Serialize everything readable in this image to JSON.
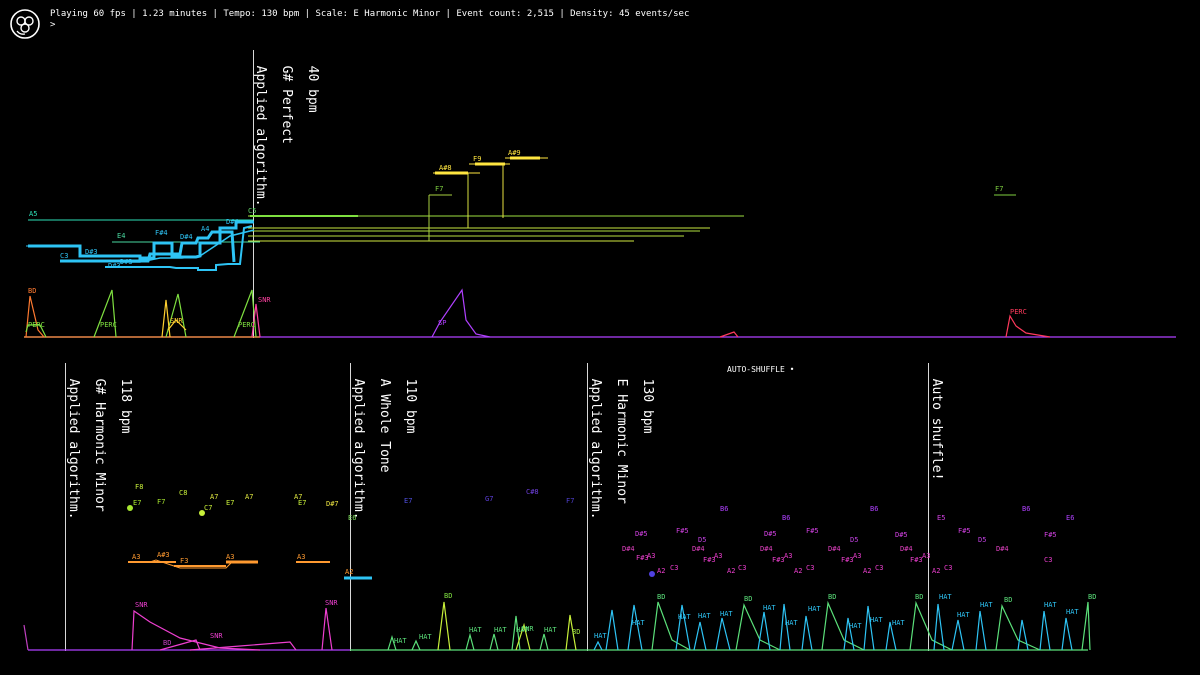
{
  "status": {
    "text": "Playing 60 fps | 1.23 minutes | Tempo: 130 bpm | Scale: E Harmonic Minor | Event count: 2,515 | Density: 45 events/sec",
    "prompt": ">"
  },
  "logo": {
    "icon": "swirl-logo-icon"
  },
  "colors": {
    "background": "#000000",
    "blue": "#2ec4f5",
    "green": "#5be07a",
    "yellow_green": "#c8f03a",
    "yellow": "#ffe640",
    "orange": "#ff9a30",
    "magenta": "#ee3fd0",
    "purple": "#b040ff",
    "red": "#ff3a5c"
  },
  "top_panel": {
    "marker": {
      "tempo": "40 bpm",
      "scale": "G# Perfect",
      "note": "Applied algorithm."
    },
    "labels": [
      {
        "text": "A5",
        "color": "#2ee0b8"
      },
      {
        "text": "E4",
        "color": "#48d9a0"
      },
      {
        "text": "F#4",
        "color": "#2ec4f5"
      },
      {
        "text": "D#4",
        "color": "#2ec4f5"
      },
      {
        "text": "A4",
        "color": "#2ec4f5"
      },
      {
        "text": "D#3",
        "color": "#2ec4f5"
      },
      {
        "text": "C3",
        "color": "#2ec4f5"
      },
      {
        "text": "D#3",
        "color": "#2ec4f5"
      },
      {
        "text": "D#3",
        "color": "#2ec4f5"
      },
      {
        "text": "D#4",
        "color": "#2ec4f5"
      },
      {
        "text": "C5",
        "color": "#64d86a"
      },
      {
        "text": "A#8",
        "color": "#ffe640"
      },
      {
        "text": "F9",
        "color": "#ffe640"
      },
      {
        "text": "A#9",
        "color": "#ffe640"
      },
      {
        "text": "F7",
        "color": "#7fd040"
      },
      {
        "text": "F7",
        "color": "#7fd040"
      },
      {
        "text": "BD",
        "color": "#ff7a30"
      },
      {
        "text": "PERC",
        "color": "#7fe040"
      },
      {
        "text": "PERC",
        "color": "#7fe040"
      },
      {
        "text": "SNR",
        "color": "#ffd030"
      },
      {
        "text": "PERC",
        "color": "#7fe040"
      },
      {
        "text": "SNR",
        "color": "#ff40a0"
      },
      {
        "text": "SP",
        "color": "#b040ff"
      },
      {
        "text": "PERC",
        "color": "#ff3a5c"
      }
    ]
  },
  "bottom_panel": {
    "badge": "AUTO-SHUFFLE •",
    "markers": [
      {
        "tempo": "118 bpm",
        "scale": "G# Harmonic Minor",
        "note": "Applied algorithm."
      },
      {
        "tempo": "110 bpm",
        "scale": "A Whole Tone",
        "note": "Applied algorithm."
      },
      {
        "tempo": "130 bpm",
        "scale": "E Harmonic Minor",
        "note": "Applied algorithm."
      },
      {
        "tempo": "",
        "scale": "",
        "note": "Auto shuffle!"
      }
    ],
    "labels": [
      {
        "text": "F8",
        "color": "#c8f03a"
      },
      {
        "text": "E7",
        "color": "#a8e830"
      },
      {
        "text": "F7",
        "color": "#a8e830"
      },
      {
        "text": "C8",
        "color": "#c8f03a"
      },
      {
        "text": "C7",
        "color": "#c8f03a"
      },
      {
        "text": "A7",
        "color": "#e0e840"
      },
      {
        "text": "E7",
        "color": "#c8f03a"
      },
      {
        "text": "A7",
        "color": "#e0e840"
      },
      {
        "text": "A7",
        "color": "#e0e840"
      },
      {
        "text": "E7",
        "color": "#c8f03a"
      },
      {
        "text": "D#7",
        "color": "#e8e040"
      },
      {
        "text": "E6",
        "color": "#80e060"
      },
      {
        "text": "A3",
        "color": "#ff9a30"
      },
      {
        "text": "A#3",
        "color": "#ff9a30"
      },
      {
        "text": "F3",
        "color": "#ff9a30"
      },
      {
        "text": "A3",
        "color": "#ff9a30"
      },
      {
        "text": "A3",
        "color": "#ff9a30"
      },
      {
        "text": "A2",
        "color": "#ff9a30"
      },
      {
        "text": "E7",
        "color": "#5050e0"
      },
      {
        "text": "G7",
        "color": "#6040e0"
      },
      {
        "text": "C#8",
        "color": "#7040e0"
      },
      {
        "text": "F7",
        "color": "#5040d0"
      },
      {
        "text": "B6",
        "color": "#b040ff"
      },
      {
        "text": "B6",
        "color": "#b040ff"
      },
      {
        "text": "B6",
        "color": "#b040ff"
      },
      {
        "text": "B6",
        "color": "#b040ff"
      },
      {
        "text": "D#5",
        "color": "#d040e0"
      },
      {
        "text": "F#5",
        "color": "#d040e0"
      },
      {
        "text": "D5",
        "color": "#c040e0"
      },
      {
        "text": "D#5",
        "color": "#d040e0"
      },
      {
        "text": "F#5",
        "color": "#d040e0"
      },
      {
        "text": "D5",
        "color": "#c040e0"
      },
      {
        "text": "D#5",
        "color": "#d040e0"
      },
      {
        "text": "E5",
        "color": "#d040e0"
      },
      {
        "text": "F#5",
        "color": "#d040e0"
      },
      {
        "text": "D5",
        "color": "#c040e0"
      },
      {
        "text": "F#5",
        "color": "#d040e0"
      },
      {
        "text": "E6",
        "color": "#b040ff"
      },
      {
        "text": "D#4",
        "color": "#e040c0"
      },
      {
        "text": "D#4",
        "color": "#e040c0"
      },
      {
        "text": "D#4",
        "color": "#e040c0"
      },
      {
        "text": "D#4",
        "color": "#e040c0"
      },
      {
        "text": "D#4",
        "color": "#e040c0"
      },
      {
        "text": "D#4",
        "color": "#e040c0"
      },
      {
        "text": "F#3",
        "color": "#ee3fd0"
      },
      {
        "text": "A3",
        "color": "#ee3fd0"
      },
      {
        "text": "F#3",
        "color": "#ee3fd0"
      },
      {
        "text": "A3",
        "color": "#ee3fd0"
      },
      {
        "text": "F#3",
        "color": "#ee3fd0"
      },
      {
        "text": "A3",
        "color": "#ee3fd0"
      },
      {
        "text": "F#3",
        "color": "#ee3fd0"
      },
      {
        "text": "A3",
        "color": "#ee3fd0"
      },
      {
        "text": "F#3",
        "color": "#ee3fd0"
      },
      {
        "text": "A3",
        "color": "#ee3fd0"
      },
      {
        "text": "C3",
        "color": "#ee3fd0"
      },
      {
        "text": "A2",
        "color": "#ee3fd0"
      },
      {
        "text": "C3",
        "color": "#ee3fd0"
      },
      {
        "text": "A2",
        "color": "#ee3fd0"
      },
      {
        "text": "C3",
        "color": "#ee3fd0"
      },
      {
        "text": "A2",
        "color": "#ee3fd0"
      },
      {
        "text": "C3",
        "color": "#ee3fd0"
      },
      {
        "text": "A2",
        "color": "#ee3fd0"
      },
      {
        "text": "C3",
        "color": "#ee3fd0"
      },
      {
        "text": "A2",
        "color": "#ee3fd0"
      },
      {
        "text": "C3",
        "color": "#ee3fd0"
      },
      {
        "text": "SNR",
        "color": "#ee3fd0"
      },
      {
        "text": "SNR",
        "color": "#ee3fd0"
      },
      {
        "text": "SNR",
        "color": "#ee3fd0"
      },
      {
        "text": "BD",
        "color": "#c040c0"
      },
      {
        "text": "BD",
        "color": "#7fe040"
      },
      {
        "text": "HAT",
        "color": "#5be07a"
      },
      {
        "text": "HAT",
        "color": "#5be07a"
      },
      {
        "text": "HAT",
        "color": "#5be07a"
      },
      {
        "text": "HAT",
        "color": "#5be07a"
      },
      {
        "text": "SNR",
        "color": "#5be07a"
      },
      {
        "text": "HAT",
        "color": "#5be07a"
      },
      {
        "text": "HAT",
        "color": "#5be07a"
      },
      {
        "text": "BD",
        "color": "#a0e040"
      },
      {
        "text": "HAT",
        "color": "#2ec4f5"
      },
      {
        "text": "HAT",
        "color": "#2ec4f5"
      },
      {
        "text": "BD",
        "color": "#5be07a"
      },
      {
        "text": "HAT",
        "color": "#2ec4f5"
      },
      {
        "text": "HAT",
        "color": "#2ec4f5"
      },
      {
        "text": "HAT",
        "color": "#2ec4f5"
      },
      {
        "text": "BD",
        "color": "#5be07a"
      },
      {
        "text": "HAT",
        "color": "#2ec4f5"
      },
      {
        "text": "HAT",
        "color": "#2ec4f5"
      },
      {
        "text": "HAT",
        "color": "#2ec4f5"
      },
      {
        "text": "BD",
        "color": "#5be07a"
      },
      {
        "text": "HAT",
        "color": "#2ec4f5"
      },
      {
        "text": "HAT",
        "color": "#2ec4f5"
      },
      {
        "text": "HAT",
        "color": "#2ec4f5"
      },
      {
        "text": "BD",
        "color": "#5be07a"
      },
      {
        "text": "HAT",
        "color": "#2ec4f5"
      },
      {
        "text": "HAT",
        "color": "#2ec4f5"
      },
      {
        "text": "BD",
        "color": "#5be07a"
      },
      {
        "text": "HAT",
        "color": "#2ec4f5"
      },
      {
        "text": "HAT",
        "color": "#2ec4f5"
      },
      {
        "text": "HAT",
        "color": "#2ec4f5"
      },
      {
        "text": "BD",
        "color": "#5be07a"
      },
      {
        "text": "HAT",
        "color": "#2ec4f5"
      },
      {
        "text": "BD",
        "color": "#5be07a"
      }
    ]
  }
}
